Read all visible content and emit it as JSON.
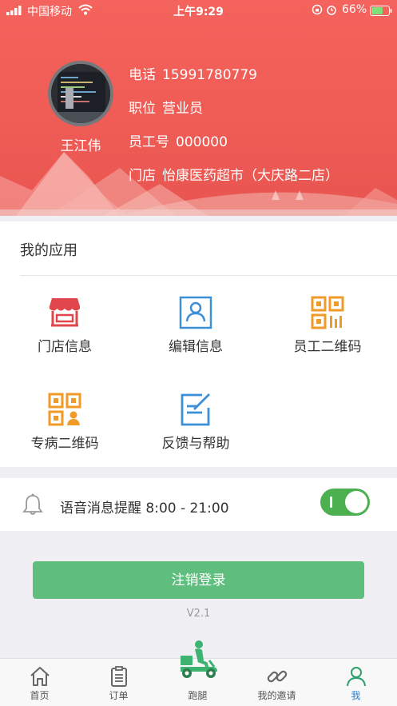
{
  "status_bar": {
    "carrier": "中国移动",
    "time": "上午9:29",
    "battery_percent": "66%",
    "battery_level": 0.66
  },
  "profile": {
    "name": "王江伟",
    "phone_label": "电话",
    "phone": "15991780779",
    "position_label": "职位",
    "position": "营业员",
    "employee_no_label": "员工号",
    "employee_no": "000000",
    "store_label": "门店",
    "store": "怡康医药超市（大庆路二店）"
  },
  "apps": {
    "title": "我的应用",
    "items": [
      {
        "label": "门店信息",
        "icon": "storefront-icon"
      },
      {
        "label": "编辑信息",
        "icon": "user-card-icon"
      },
      {
        "label": "员工二维码",
        "icon": "qr-code-icon"
      },
      {
        "label": "专病二维码",
        "icon": "qr-code-person-icon"
      },
      {
        "label": "反馈与帮助",
        "icon": "edit-note-icon"
      }
    ]
  },
  "reminder": {
    "label": "语音消息提醒 8:00 - 21:00",
    "enabled": true
  },
  "logout_label": "注销登录",
  "version": "V2.1",
  "tabs": [
    {
      "label": "首页",
      "icon": "home-icon"
    },
    {
      "label": "订单",
      "icon": "clipboard-icon"
    },
    {
      "label": "跑腿",
      "icon": "delivery-rider-icon"
    },
    {
      "label": "我的邀请",
      "icon": "link-icon"
    },
    {
      "label": "我",
      "icon": "person-icon"
    }
  ],
  "colors": {
    "header": "#ef5b55",
    "green_button": "#5fbe7d",
    "toggle_on": "#4caf50",
    "tab_active": "#2c7fd8",
    "icon_red": "#e0464b",
    "icon_blue": "#3d8fd6",
    "icon_orange": "#f09a27"
  }
}
